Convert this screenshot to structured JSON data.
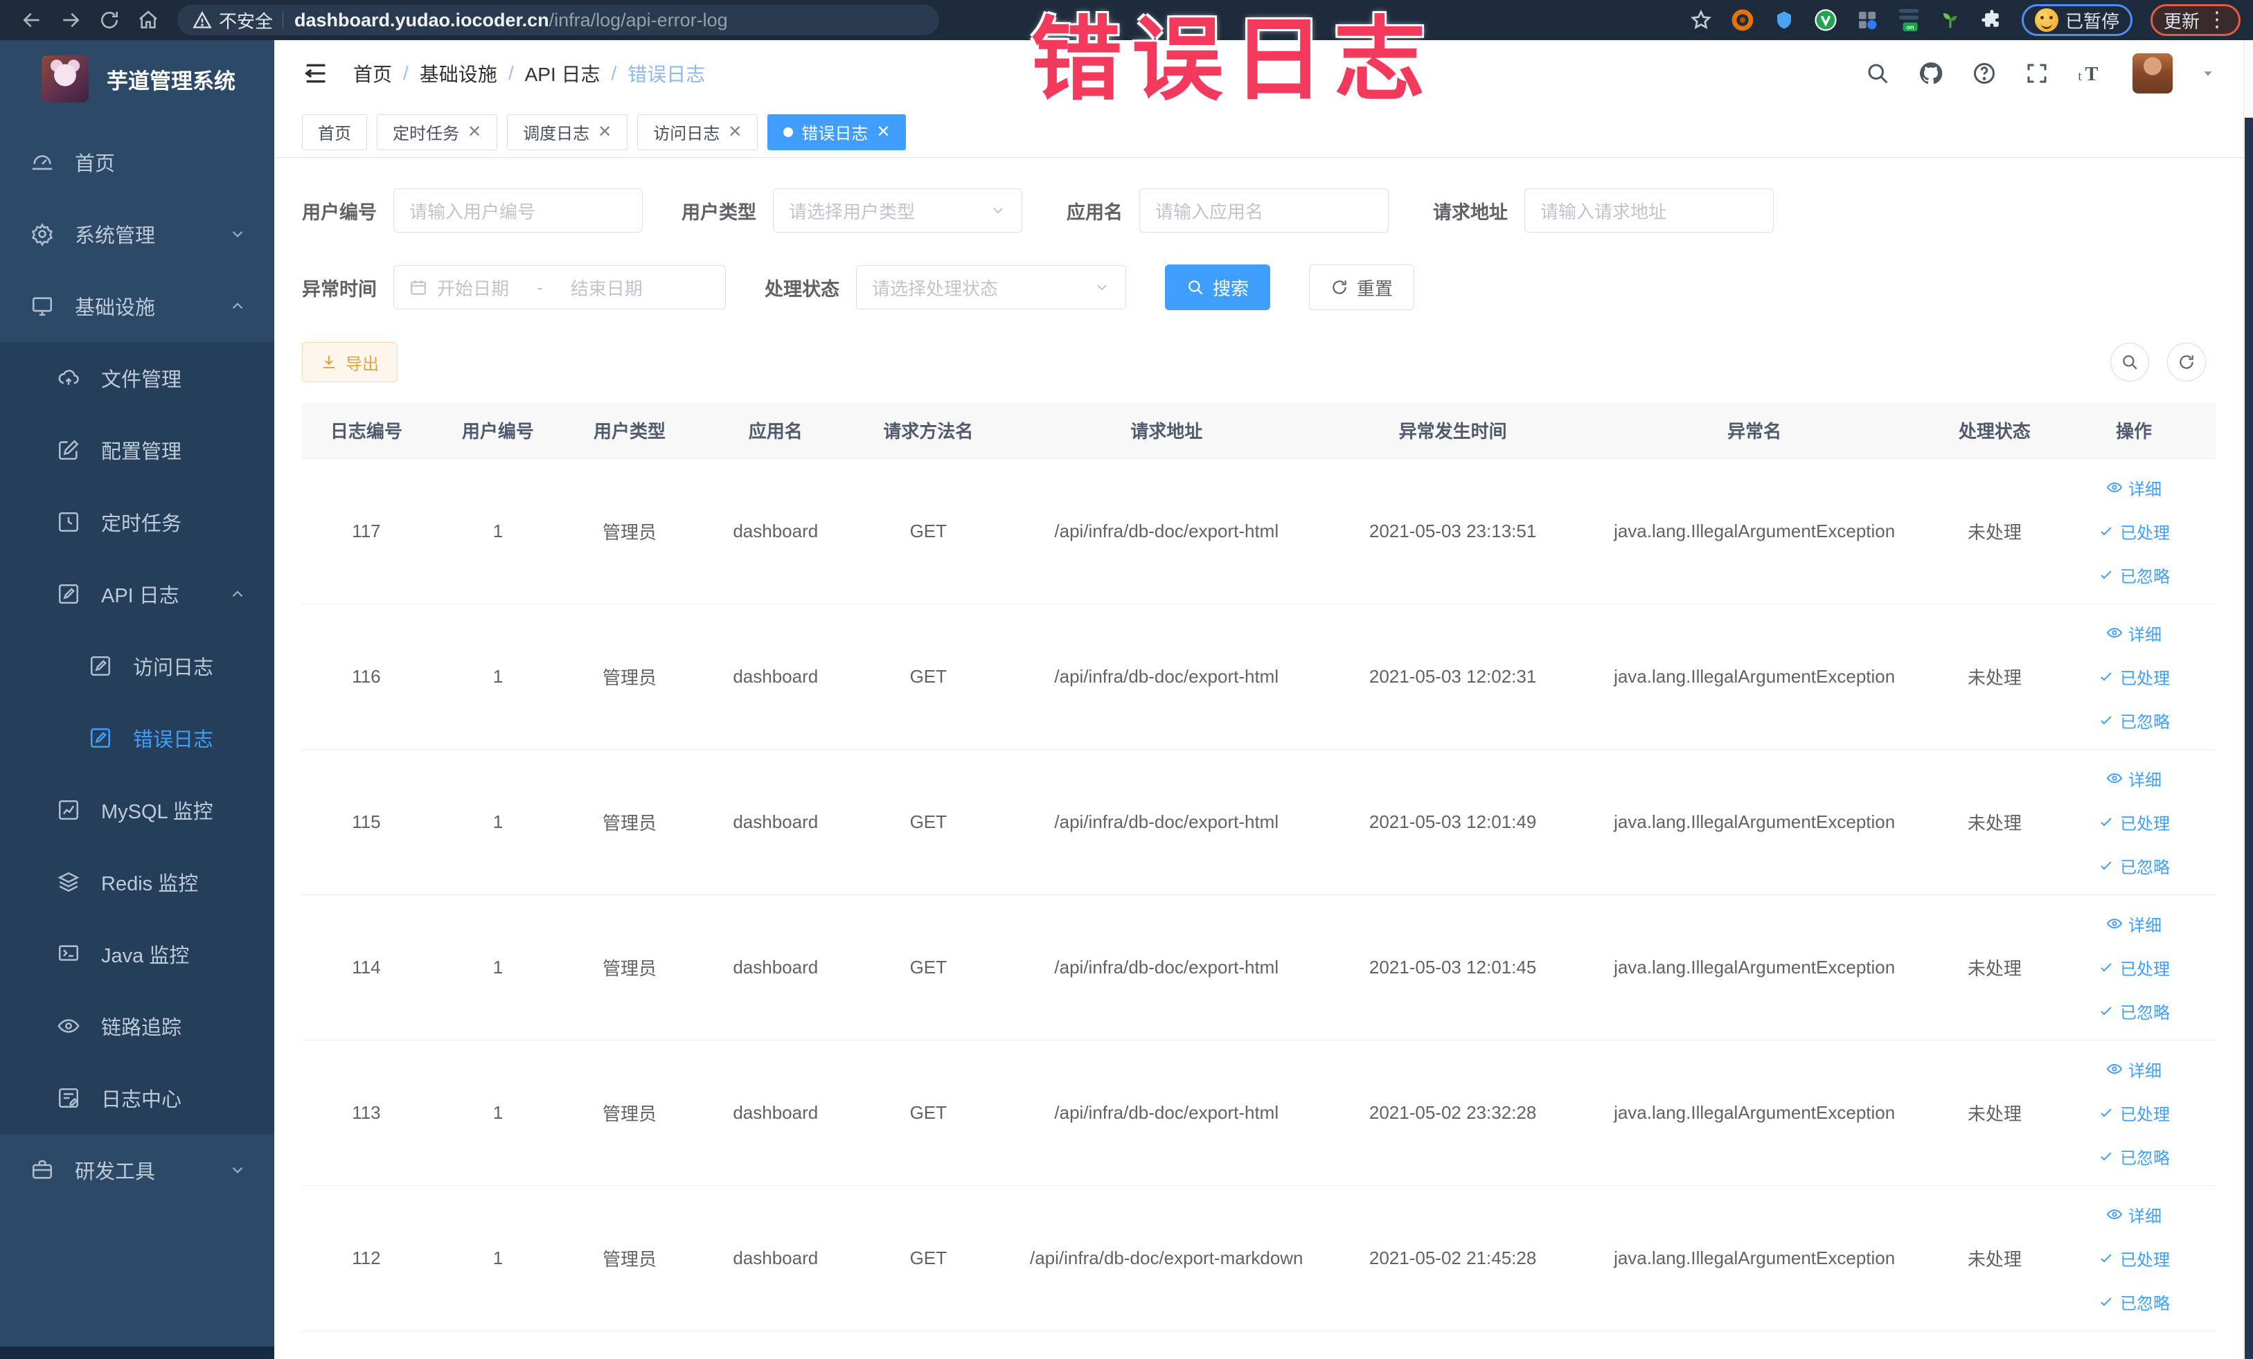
{
  "browser": {
    "security_label": "不安全",
    "url_domain": "dashboard.yudao.iocoder.cn",
    "url_path": "/infra/log/api-error-log",
    "paused_badge": "已暂停",
    "update_label": "更新"
  },
  "overlay": {
    "title": "错误日志"
  },
  "sidebar": {
    "app_title": "芋道管理系统",
    "menu": [
      {
        "label": "首页"
      },
      {
        "label": "系统管理"
      },
      {
        "label": "基础设施"
      },
      {
        "label": "文件管理"
      },
      {
        "label": "配置管理"
      },
      {
        "label": "定时任务"
      },
      {
        "label": "API 日志"
      },
      {
        "label": "访问日志"
      },
      {
        "label": "错误日志"
      },
      {
        "label": "MySQL 监控"
      },
      {
        "label": "Redis 监控"
      },
      {
        "label": "Java 监控"
      },
      {
        "label": "链路追踪"
      },
      {
        "label": "日志中心"
      },
      {
        "label": "研发工具"
      }
    ]
  },
  "header": {
    "breadcrumb": [
      "首页",
      "基础设施",
      "API 日志",
      "错误日志"
    ]
  },
  "tabs": [
    {
      "label": "首页"
    },
    {
      "label": "定时任务"
    },
    {
      "label": "调度日志"
    },
    {
      "label": "访问日志"
    },
    {
      "label": "错误日志"
    }
  ],
  "filters": {
    "user_id_label": "用户编号",
    "user_id_placeholder": "请输入用户编号",
    "user_type_label": "用户类型",
    "user_type_placeholder": "请选择用户类型",
    "app_name_label": "应用名",
    "app_name_placeholder": "请输入应用名",
    "request_url_label": "请求地址",
    "request_url_placeholder": "请输入请求地址",
    "exception_time_label": "异常时间",
    "date_start_placeholder": "开始日期",
    "date_separator": "-",
    "date_end_placeholder": "结束日期",
    "process_status_label": "处理状态",
    "process_status_placeholder": "请选择处理状态",
    "search_label": "搜索",
    "reset_label": "重置"
  },
  "toolbar": {
    "export_label": "导出"
  },
  "table": {
    "columns": [
      "日志编号",
      "用户编号",
      "用户类型",
      "应用名",
      "请求方法名",
      "请求地址",
      "异常发生时间",
      "异常名",
      "处理状态",
      "操作"
    ],
    "action_labels": [
      "详细",
      "已处理",
      "已忽略"
    ],
    "rows": [
      {
        "id": "117",
        "user_id": "1",
        "user_type": "管理员",
        "app": "dashboard",
        "method": "GET",
        "url": "/api/infra/db-doc/export-html",
        "time": "2021-05-03 23:13:51",
        "exception": "java.lang.IllegalArgumentException",
        "status": "未处理"
      },
      {
        "id": "116",
        "user_id": "1",
        "user_type": "管理员",
        "app": "dashboard",
        "method": "GET",
        "url": "/api/infra/db-doc/export-html",
        "time": "2021-05-03 12:02:31",
        "exception": "java.lang.IllegalArgumentException",
        "status": "未处理"
      },
      {
        "id": "115",
        "user_id": "1",
        "user_type": "管理员",
        "app": "dashboard",
        "method": "GET",
        "url": "/api/infra/db-doc/export-html",
        "time": "2021-05-03 12:01:49",
        "exception": "java.lang.IllegalArgumentException",
        "status": "未处理"
      },
      {
        "id": "114",
        "user_id": "1",
        "user_type": "管理员",
        "app": "dashboard",
        "method": "GET",
        "url": "/api/infra/db-doc/export-html",
        "time": "2021-05-03 12:01:45",
        "exception": "java.lang.IllegalArgumentException",
        "status": "未处理"
      },
      {
        "id": "113",
        "user_id": "1",
        "user_type": "管理员",
        "app": "dashboard",
        "method": "GET",
        "url": "/api/infra/db-doc/export-html",
        "time": "2021-05-02 23:32:28",
        "exception": "java.lang.IllegalArgumentException",
        "status": "未处理"
      },
      {
        "id": "112",
        "user_id": "1",
        "user_type": "管理员",
        "app": "dashboard",
        "method": "GET",
        "url": "/api/infra/db-doc/export-markdown",
        "time": "2021-05-02 21:45:28",
        "exception": "java.lang.IllegalArgumentException",
        "status": "未处理"
      }
    ]
  },
  "colors": {
    "primary": "#409eff",
    "annotation_red": "#f43a5c",
    "warning_text": "#e6a23c",
    "sidebar_bg": "#2d4968"
  }
}
